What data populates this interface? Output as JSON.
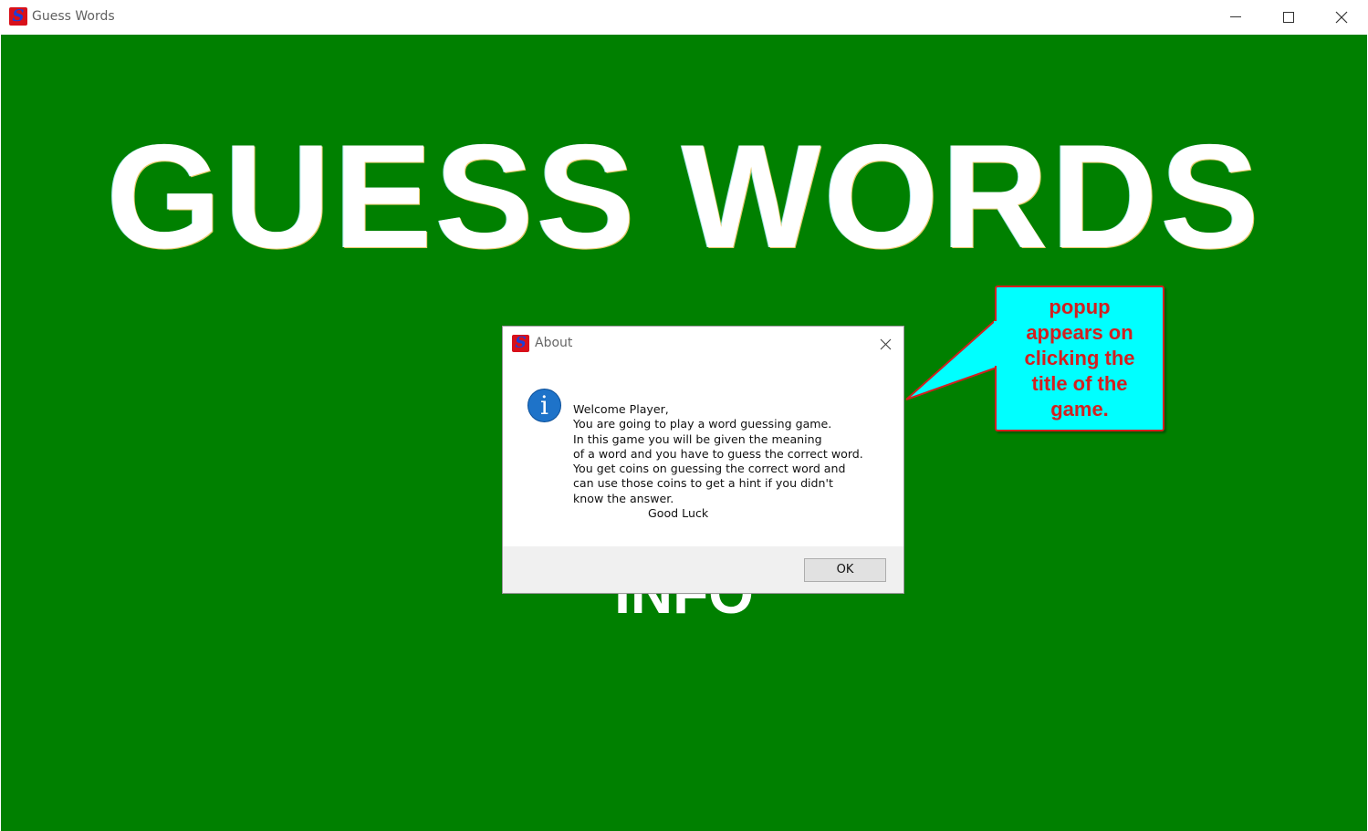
{
  "window": {
    "title": "Guess Words",
    "app_icon_letter": "S"
  },
  "game": {
    "background_color": "#008000",
    "title": "GUESS WORDS",
    "info_label": "INFO"
  },
  "dialog": {
    "title": "About",
    "icon": "info-icon",
    "icon_glyph": "i",
    "message_lines": [
      "Welcome Player,",
      "You are going to play a word guessing game.",
      "In this game you will be given the meaning",
      "of a word and you have to guess the correct word.",
      "You get coins on guessing the correct word and",
      "can use those coins to get a hint if you didn't",
      "know the answer.",
      "Good Luck"
    ],
    "ok_label": "OK"
  },
  "annotation": {
    "lines": [
      "popup",
      "appears on",
      "clicking the",
      "title of the",
      "game."
    ],
    "fill_color": "#00ffff",
    "border_color": "#d31f1f",
    "text_color": "#d31f1f"
  }
}
